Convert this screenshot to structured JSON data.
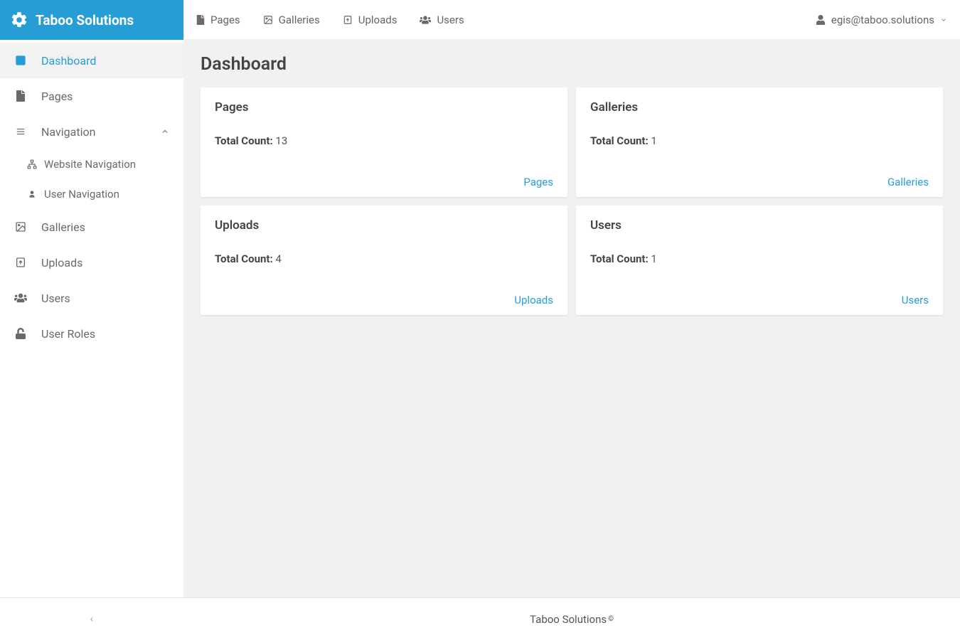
{
  "brand": {
    "name": "Taboo Solutions"
  },
  "sidebar": {
    "items": [
      {
        "label": "Dashboard"
      },
      {
        "label": "Pages"
      },
      {
        "label": "Navigation"
      },
      {
        "label": "Galleries"
      },
      {
        "label": "Uploads"
      },
      {
        "label": "Users"
      },
      {
        "label": "User Roles"
      }
    ],
    "navigation_children": [
      {
        "label": "Website Navigation"
      },
      {
        "label": "User Navigation"
      }
    ]
  },
  "topnav": {
    "items": [
      {
        "label": "Pages"
      },
      {
        "label": "Galleries"
      },
      {
        "label": "Uploads"
      },
      {
        "label": "Users"
      }
    ]
  },
  "user": {
    "email": "egis@taboo.solutions"
  },
  "page": {
    "title": "Dashboard"
  },
  "cards": [
    {
      "title": "Pages",
      "count_label": "Total Count:",
      "count": "13",
      "link": "Pages"
    },
    {
      "title": "Galleries",
      "count_label": "Total Count:",
      "count": "1",
      "link": "Galleries"
    },
    {
      "title": "Uploads",
      "count_label": "Total Count:",
      "count": "4",
      "link": "Uploads"
    },
    {
      "title": "Users",
      "count_label": "Total Count:",
      "count": "1",
      "link": "Users"
    }
  ],
  "footer": {
    "text": "Taboo Solutions",
    "symbol": "©"
  }
}
